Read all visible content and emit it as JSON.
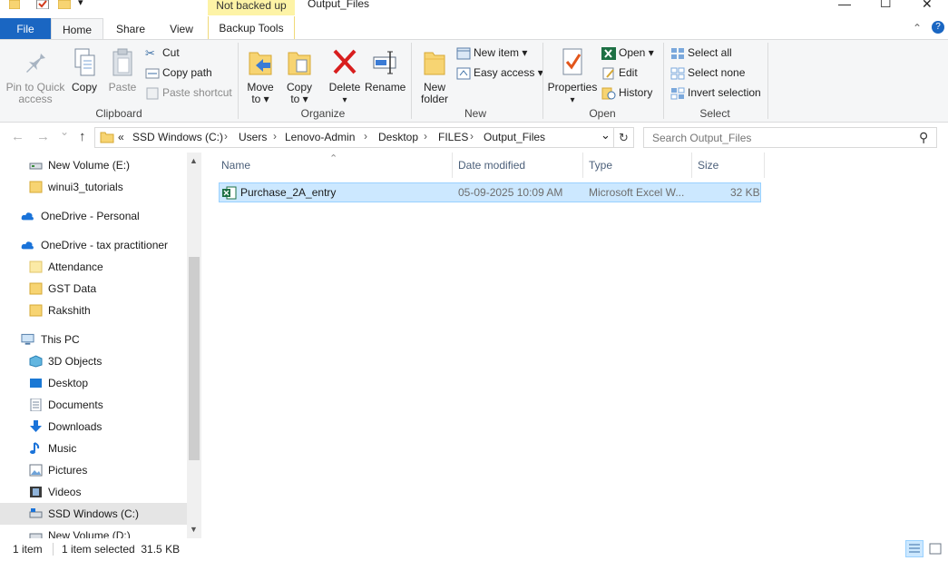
{
  "titlebar": {
    "context_tab": "Not backed up",
    "window_title": "Output_Files",
    "minimize": "—",
    "maximize": "☐",
    "close": "✕"
  },
  "tabs": {
    "file": "File",
    "home": "Home",
    "share": "Share",
    "view": "View",
    "backup_tools": "Backup Tools",
    "collapse": "⌃",
    "help": "?"
  },
  "ribbon": {
    "clipboard": {
      "label": "Clipboard",
      "pin": "Pin to Quick\naccess",
      "pin_line1": "Pin to Quick",
      "pin_line2": "access",
      "copy": "Copy",
      "paste": "Paste",
      "cut": "Cut",
      "copy_path": "Copy path",
      "paste_shortcut": "Paste shortcut"
    },
    "organize": {
      "label": "Organize",
      "move_to_1": "Move",
      "move_to_2": "to ▾",
      "copy_to_1": "Copy",
      "copy_to_2": "to ▾",
      "delete": "Delete",
      "delete_arrow": "▾",
      "rename": "Rename"
    },
    "new": {
      "label": "New",
      "new_folder_1": "New",
      "new_folder_2": "folder",
      "new_item": "New item ▾",
      "easy_access": "Easy access ▾"
    },
    "open": {
      "label": "Open",
      "properties": "Properties",
      "properties_arrow": "▾",
      "open": "Open ▾",
      "edit": "Edit",
      "history": "History"
    },
    "select": {
      "label": "Select",
      "select_all": "Select all",
      "select_none": "Select none",
      "invert": "Invert selection"
    }
  },
  "address": {
    "back": "←",
    "forward": "→",
    "recent": "⌄",
    "up": "↑",
    "overflow": "«",
    "crumbs": [
      "SSD Windows (C:)",
      "Users",
      "Lenovo-Admin",
      "Desktop",
      "FILES",
      "Output_Files"
    ],
    "separator": "›",
    "dropdown": "⌄",
    "refresh": "↻",
    "search_placeholder": "Search Output_Files",
    "search_icon": "⚲"
  },
  "navpane": {
    "items": [
      {
        "label": "New Volume (E:)",
        "icon": "drive-icon"
      },
      {
        "label": "winui3_tutorials",
        "icon": "folder-icon"
      },
      {
        "label": "OneDrive - Personal",
        "icon": "cloud-icon"
      },
      {
        "label": "OneDrive - tax practitioner",
        "icon": "cloud-icon"
      },
      {
        "label": "Attendance",
        "icon": "folder-icon"
      },
      {
        "label": "GST Data",
        "icon": "folder-icon"
      },
      {
        "label": "Rakshith",
        "icon": "folder-icon"
      },
      {
        "label": "This PC",
        "icon": "pc-icon"
      },
      {
        "label": "3D Objects",
        "icon": "cube-icon"
      },
      {
        "label": "Desktop",
        "icon": "desktop-icon"
      },
      {
        "label": "Documents",
        "icon": "document-icon"
      },
      {
        "label": "Downloads",
        "icon": "download-icon"
      },
      {
        "label": "Music",
        "icon": "music-icon"
      },
      {
        "label": "Pictures",
        "icon": "picture-icon"
      },
      {
        "label": "Videos",
        "icon": "video-icon"
      },
      {
        "label": "SSD Windows (C:)",
        "icon": "drive-icon"
      },
      {
        "label": "New Volume (D:)",
        "icon": "drive-icon"
      }
    ],
    "scroll_up": "▲",
    "scroll_down": "▼"
  },
  "filelist": {
    "sort_indicator": "⌃",
    "columns": [
      "Name",
      "Date modified",
      "Type",
      "Size"
    ],
    "rows": [
      {
        "name": "Purchase_2A_entry",
        "date": "05-09-2025 10:09 AM",
        "type": "Microsoft Excel W...",
        "size": "32 KB"
      }
    ]
  },
  "status": {
    "count": "1 item",
    "selection": "1 item selected  31.5 KB"
  },
  "colors": {
    "accent": "#1a66c2",
    "selection_bg": "#cce8ff",
    "selection_border": "#99d1ff",
    "context_tab": "#fdf3a6",
    "folder": "#f7d472",
    "delete_red": "#d81e1e",
    "excel_green": "#1d7044"
  }
}
